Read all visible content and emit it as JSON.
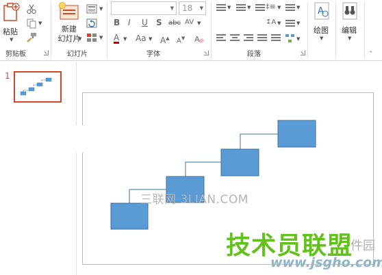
{
  "ribbon": {
    "clipboard": {
      "paste_label": "粘贴",
      "group_label": "剪贴板"
    },
    "slides": {
      "new_slide_label": "新建\n幻灯片",
      "group_label": "幻灯片"
    },
    "font": {
      "font_size": "18",
      "group_label": "字体"
    },
    "paragraph": {
      "group_label": "段落"
    },
    "drawing": {
      "drawing_label": "绘图"
    },
    "editing": {
      "editing_label": "编辑"
    }
  },
  "thumbnails": [
    {
      "number": "1",
      "selected": true
    }
  ],
  "slide_content": {
    "shape_color": "#5b9bd5",
    "connector_color": "#41719c"
  },
  "watermarks": {
    "site_text": "三联网 3LIAN.COM",
    "brand_text": "技术员联盟",
    "brand_suffix": "件园",
    "url_text": "www.jsgho.com",
    "brand_color": "#63c11b"
  },
  "colors": {
    "accent": "#d24726",
    "slide_border": "#b9b9b9"
  }
}
